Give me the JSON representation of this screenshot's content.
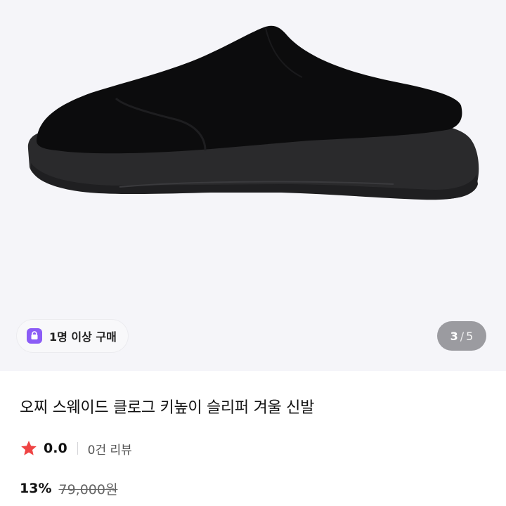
{
  "product_image": {
    "alt": "black suede clog slipper",
    "current_page": "3",
    "separator": "/",
    "total_pages": "5"
  },
  "badge": {
    "icon": "shopping-bag-icon",
    "label": "1명 이상 구매",
    "icon_color": "#8b5cf6"
  },
  "product": {
    "title": "오찌 스웨이드 클로그 키높이 슬리퍼 겨울 신발",
    "rating": "0.0",
    "rating_icon": "star-icon",
    "rating_icon_color": "#ef4444",
    "review_count_label": "0건 리뷰",
    "discount": "13%",
    "original_price": "79,000원"
  }
}
